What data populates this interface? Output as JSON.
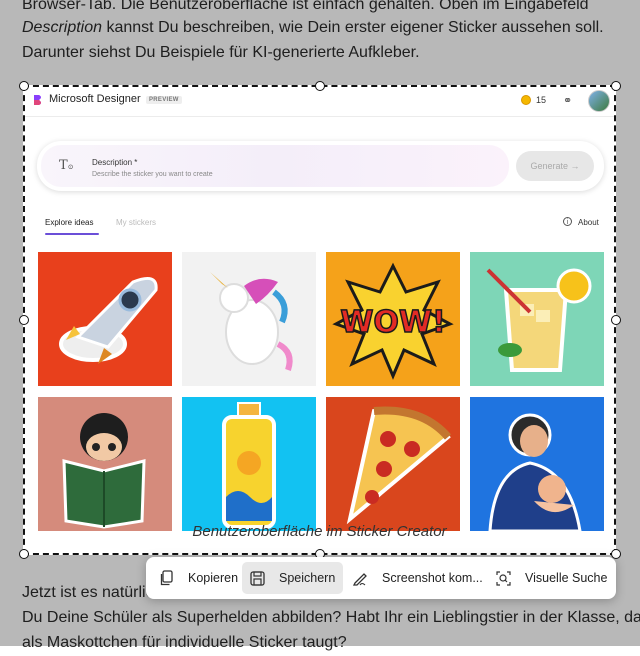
{
  "article": {
    "line1": "Browser-Tab. Die Benutzeroberfläche ist einfach gehalten. Oben im Eingabefeld",
    "line2_em": "Description",
    "line2_rest": " kannst Du beschreiben, wie Dein erster eigener Sticker aussehen soll.",
    "line3": "Darunter siehst Du Beispiele für KI-generierte Aufkleber.",
    "line4": "Jetzt ist es natürlic",
    "line5": "Du Deine Schüler als Superhelden abbilden? Habt Ihr ein Lieblingstier in der Klasse, das",
    "line6": "als Maskottchen für individuelle Sticker taugt?"
  },
  "designer": {
    "app_name": "Microsoft Designer",
    "badge": "PREVIEW",
    "coins": "15",
    "prompt_label": "Description *",
    "prompt_placeholder": "Describe the sticker you want to create",
    "generate_label": "Generate →",
    "tabs": [
      "Explore ideas",
      "My stickers"
    ],
    "about_label": "About",
    "stickers": [
      {
        "name": "rocket-sticker",
        "bg": "#e8401c"
      },
      {
        "name": "unicorn-sticker",
        "bg": "#f2f2f2"
      },
      {
        "name": "wow-sticker",
        "bg": "#f5a21a"
      },
      {
        "name": "lemonade-sticker",
        "bg": "#7ed6b7"
      },
      {
        "name": "reader-sticker",
        "bg": "#d58b7c"
      },
      {
        "name": "sunscreen-sticker",
        "bg": "#12c2f2"
      },
      {
        "name": "pizza-sticker",
        "bg": "#d9461d"
      },
      {
        "name": "parent-baby-sticker",
        "bg": "#1f74e0"
      }
    ]
  },
  "caption": "Benutzeroberfläche im Sticker Creator",
  "toolbar": {
    "copy": "Kopieren",
    "save": "Speichern",
    "screenshot": "Screenshot kom...",
    "visual_search": "Visuelle Suche"
  }
}
